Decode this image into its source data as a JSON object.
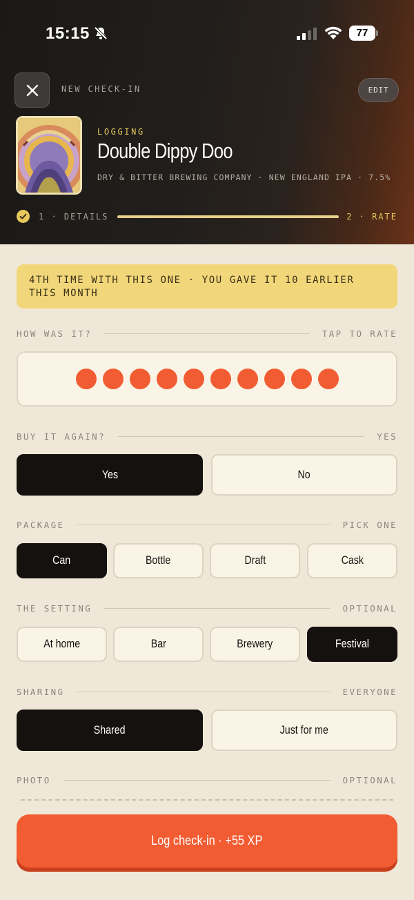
{
  "status_bar": {
    "time": "15:15",
    "battery": "77"
  },
  "header": {
    "title": "NEW CHECK-IN",
    "edit_label": "EDIT",
    "logging_label": "LOGGING",
    "beer_name": "Double Dippy Doo",
    "beer_meta": "DRY & BITTER BREWING COMPANY · NEW ENGLAND IPA · 7.5%",
    "progress": {
      "step1": "1 · DETAILS",
      "step2": "2 · RATE",
      "fraction": 1.0
    }
  },
  "banner": {
    "text": "4TH TIME WITH THIS ONE · YOU GAVE IT 10 EARLIER THIS MONTH"
  },
  "rating": {
    "label": "HOW WAS IT?",
    "hint": "TAP TO RATE",
    "value": 10,
    "max": 10
  },
  "buy_again": {
    "label": "BUY IT AGAIN?",
    "value": "YES",
    "options": [
      "Yes",
      "No"
    ],
    "selected": "Yes"
  },
  "package": {
    "label": "PACKAGE",
    "hint": "PICK ONE",
    "options": [
      "Can",
      "Bottle",
      "Draft",
      "Cask"
    ],
    "selected": "Can"
  },
  "setting": {
    "label": "THE SETTING",
    "hint": "OPTIONAL",
    "options": [
      "At home",
      "Bar",
      "Brewery",
      "Festival"
    ],
    "selected": "Festival"
  },
  "sharing": {
    "label": "SHARING",
    "value": "EVERYONE",
    "options": [
      "Shared",
      "Just for me"
    ],
    "selected": "Shared"
  },
  "photo": {
    "label": "PHOTO",
    "hint": "OPTIONAL"
  },
  "cta": {
    "label": "Log check-in · +55 XP"
  },
  "colors": {
    "accent": "#f25c32",
    "gold": "#e6c95f",
    "dark": "#15110f",
    "cream": "#efe8d8"
  },
  "icons": [
    "bell-slash-icon",
    "signal-icon",
    "wifi-icon",
    "battery-icon",
    "close-icon",
    "check-icon"
  ]
}
